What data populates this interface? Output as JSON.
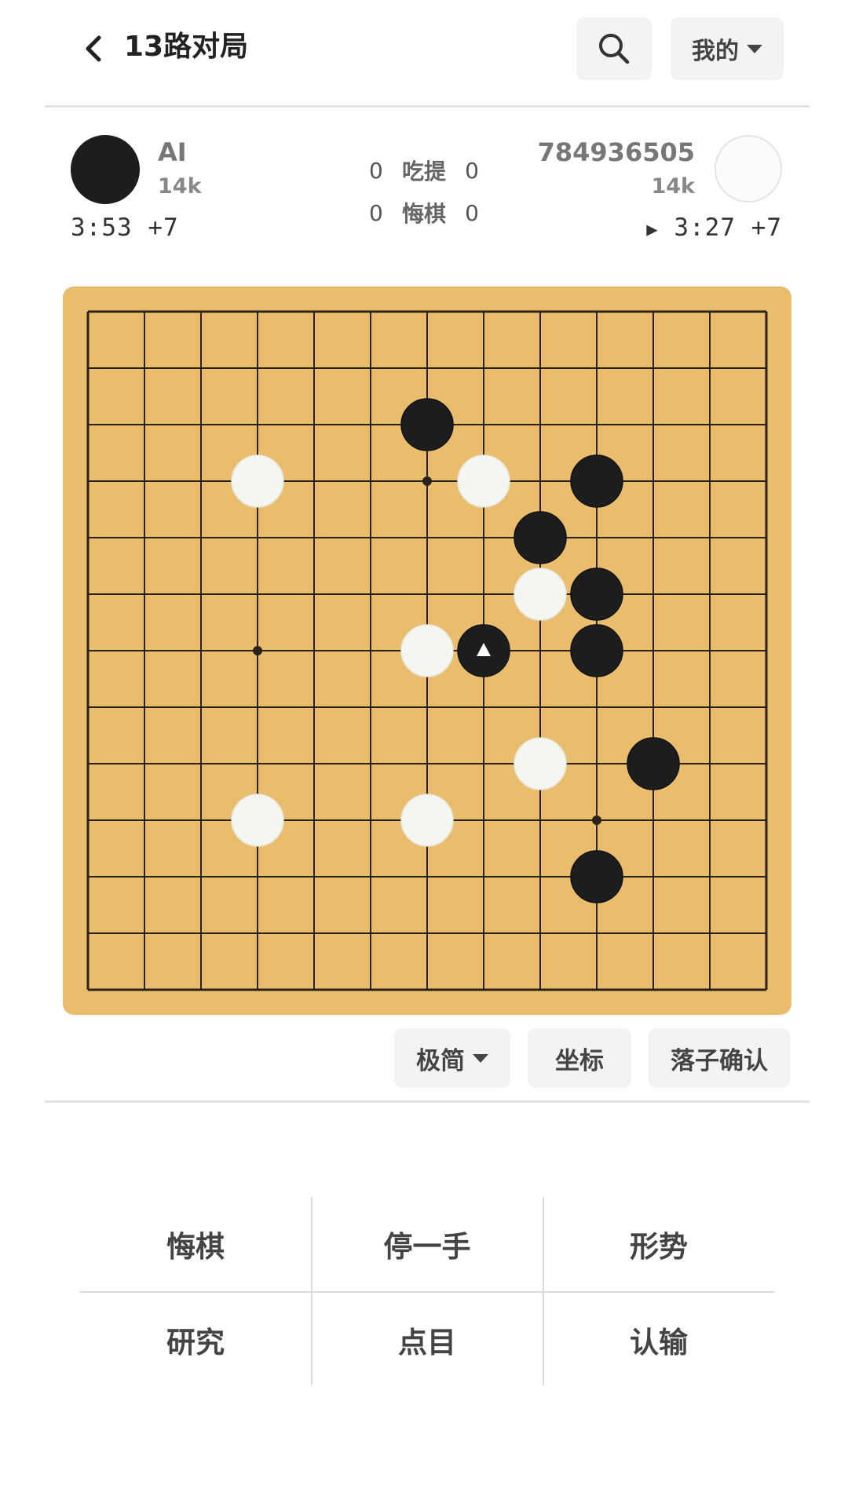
{
  "header": {
    "title": "13路对局",
    "mine_label": "我的"
  },
  "players": {
    "black": {
      "name": "AI",
      "rank": "14k",
      "clock": "3:53 +7"
    },
    "white": {
      "name": "784936505",
      "rank": "14k",
      "clock": "3:27 +7",
      "to_move_marker": "▶"
    }
  },
  "stats": {
    "captures": {
      "black": "0",
      "label": "吃提",
      "white": "0"
    },
    "undos": {
      "black": "0",
      "label": "悔棋",
      "white": "0"
    }
  },
  "board": {
    "size": 13,
    "colors": {
      "wood": "#e9bd6c",
      "line": "#2a2218",
      "black": "#1d1d1d",
      "white": "#f6f6f1"
    },
    "star_points": [
      [
        3,
        3
      ],
      [
        6,
        3
      ],
      [
        3,
        6
      ],
      [
        9,
        9
      ]
    ],
    "stones": [
      {
        "c": 6,
        "r": 2,
        "color": "black"
      },
      {
        "c": 3,
        "r": 3,
        "color": "white"
      },
      {
        "c": 7,
        "r": 3,
        "color": "white"
      },
      {
        "c": 9,
        "r": 3,
        "color": "black"
      },
      {
        "c": 8,
        "r": 4,
        "color": "black"
      },
      {
        "c": 8,
        "r": 5,
        "color": "white"
      },
      {
        "c": 9,
        "r": 5,
        "color": "black"
      },
      {
        "c": 6,
        "r": 6,
        "color": "white"
      },
      {
        "c": 7,
        "r": 6,
        "color": "black",
        "last_move": true
      },
      {
        "c": 9,
        "r": 6,
        "color": "black"
      },
      {
        "c": 8,
        "r": 8,
        "color": "white"
      },
      {
        "c": 10,
        "r": 8,
        "color": "black"
      },
      {
        "c": 3,
        "r": 9,
        "color": "white"
      },
      {
        "c": 6,
        "r": 9,
        "color": "white"
      },
      {
        "c": 9,
        "r": 10,
        "color": "black"
      }
    ]
  },
  "tools": {
    "style_label": "极简",
    "coords_label": "坐标",
    "confirm_label": "落子确认"
  },
  "actions": {
    "undo": "悔棋",
    "pass": "停一手",
    "situation": "形势",
    "study": "研究",
    "count": "点目",
    "resign": "认输"
  }
}
